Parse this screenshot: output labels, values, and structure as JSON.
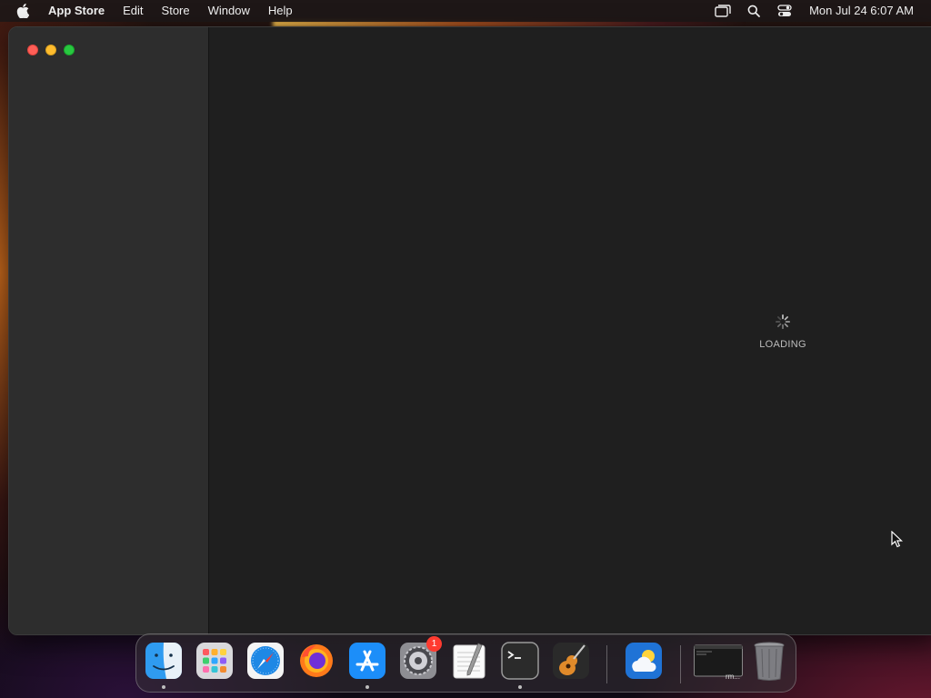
{
  "menubar": {
    "apple_icon": "apple-logo-icon",
    "app_name": "App Store",
    "menus": [
      "Edit",
      "Store",
      "Window",
      "Help"
    ],
    "status_icons": [
      "screen-mirroring-icon",
      "search-icon",
      "control-center-icon"
    ],
    "clock": "Mon Jul 24  6:07 AM"
  },
  "window": {
    "traffic_lights": [
      "close",
      "minimize",
      "maximize"
    ],
    "loading_text": "LOADING"
  },
  "dock": {
    "items": [
      {
        "name": "Finder",
        "icon": "finder-icon",
        "running": true
      },
      {
        "name": "Launchpad",
        "icon": "launchpad-icon",
        "running": false
      },
      {
        "name": "Safari",
        "icon": "safari-icon",
        "running": false
      },
      {
        "name": "Firefox",
        "icon": "firefox-icon",
        "running": false
      },
      {
        "name": "App Store",
        "icon": "app-store-icon",
        "running": true
      },
      {
        "name": "System Settings",
        "icon": "system-settings-icon",
        "running": false,
        "badge": "1"
      },
      {
        "name": "TextEdit",
        "icon": "textedit-icon",
        "running": false
      },
      {
        "name": "Terminal",
        "icon": "terminal-icon",
        "running": true
      },
      {
        "name": "GarageBand",
        "icon": "garageband-icon",
        "running": false
      },
      {
        "name": "Weather",
        "icon": "weather-icon",
        "running": false
      },
      {
        "name": "Terminal window thumbnail",
        "icon": "terminal-window-thumbnail-icon",
        "label": "rm..."
      },
      {
        "name": "Trash",
        "icon": "trash-icon",
        "running": false
      }
    ]
  },
  "colors": {
    "close": "#ff5f57",
    "minimize": "#febc2e",
    "maximize": "#28c840",
    "badge": "#ff3b30"
  }
}
